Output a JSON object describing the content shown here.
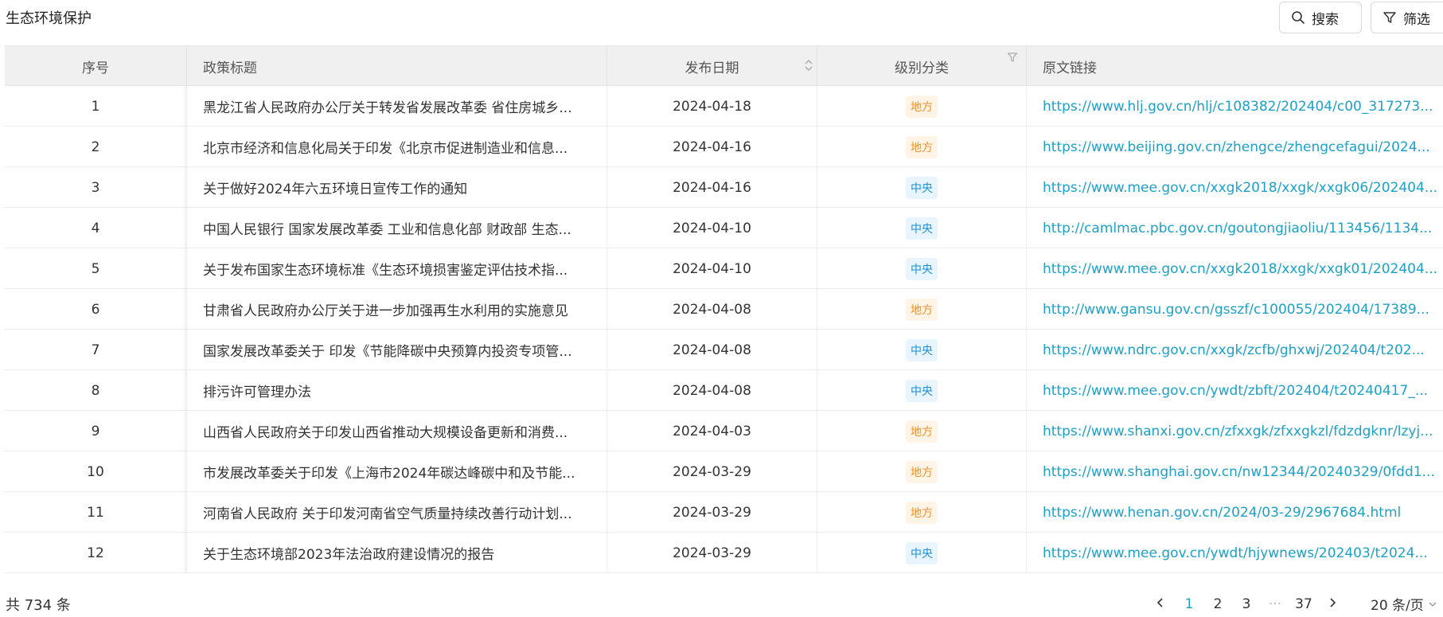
{
  "header": {
    "title": "生态环境保护",
    "search_label": "搜索",
    "filter_label": "筛选"
  },
  "table": {
    "columns": [
      "序号",
      "政策标题",
      "发布日期",
      "级别分类",
      "原文链接"
    ],
    "rows": [
      {
        "idx": "1",
        "title": "黑龙江省人民政府办公厅关于转发省发展改革委 省住房城乡...",
        "date": "2024-04-18",
        "level": "地方",
        "link": "https://www.hlj.gov.cn/hlj/c108382/202404/c00_317273..."
      },
      {
        "idx": "2",
        "title": "北京市经济和信息化局关于印发《北京市促进制造业和信息...",
        "date": "2024-04-16",
        "level": "地方",
        "link": "https://www.beijing.gov.cn/zhengce/zhengcefagui/2024..."
      },
      {
        "idx": "3",
        "title": "关于做好2024年六五环境日宣传工作的通知",
        "date": "2024-04-16",
        "level": "中央",
        "link": "https://www.mee.gov.cn/xxgk2018/xxgk/xxgk06/202404..."
      },
      {
        "idx": "4",
        "title": "中国人民银行 国家发展改革委 工业和信息化部 财政部 生态...",
        "date": "2024-04-10",
        "level": "中央",
        "link": "http://camlmac.pbc.gov.cn/goutongjiaoliu/113456/1134..."
      },
      {
        "idx": "5",
        "title": "关于发布国家生态环境标准《生态环境损害鉴定评估技术指...",
        "date": "2024-04-10",
        "level": "中央",
        "link": "https://www.mee.gov.cn/xxgk2018/xxgk/xxgk01/202404..."
      },
      {
        "idx": "6",
        "title": "甘肃省人民政府办公厅关于进一步加强再生水利用的实施意见",
        "date": "2024-04-08",
        "level": "地方",
        "link": "http://www.gansu.gov.cn/gsszf/c100055/202404/17389..."
      },
      {
        "idx": "7",
        "title": "国家发展改革委关于 印发《节能降碳中央预算内投资专项管...",
        "date": "2024-04-08",
        "level": "中央",
        "link": "https://www.ndrc.gov.cn/xxgk/zcfb/ghxwj/202404/t202..."
      },
      {
        "idx": "8",
        "title": "排污许可管理办法",
        "date": "2024-04-08",
        "level": "中央",
        "link": "https://www.mee.gov.cn/ywdt/zbft/202404/t20240417_..."
      },
      {
        "idx": "9",
        "title": "山西省人民政府关于印发山西省推动大规模设备更新和消费...",
        "date": "2024-04-03",
        "level": "地方",
        "link": "https://www.shanxi.gov.cn/zfxxgk/zfxxgkzl/fdzdgknr/lzyj..."
      },
      {
        "idx": "10",
        "title": "市发展改革委关于印发《上海市2024年碳达峰碳中和及节能...",
        "date": "2024-03-29",
        "level": "地方",
        "link": "https://www.shanghai.gov.cn/nw12344/20240329/0fdd1..."
      },
      {
        "idx": "11",
        "title": "河南省人民政府 关于印发河南省空气质量持续改善行动计划...",
        "date": "2024-03-29",
        "level": "地方",
        "link": "https://www.henan.gov.cn/2024/03-29/2967684.html"
      },
      {
        "idx": "12",
        "title": "关于生态环境部2023年法治政府建设情况的报告",
        "date": "2024-03-29",
        "level": "中央",
        "link": "https://www.mee.gov.cn/ywdt/hjywnews/202403/t2024..."
      }
    ]
  },
  "footer": {
    "total": "共 734 条",
    "pages": [
      "1",
      "2",
      "3"
    ],
    "ellipsis": "···",
    "last_page": "37",
    "current_page": "1",
    "page_size": "20 条/页"
  },
  "colors": {
    "accent": "#1da1c8",
    "tag_local": "#f0922e",
    "tag_central": "#1a8fd6"
  }
}
